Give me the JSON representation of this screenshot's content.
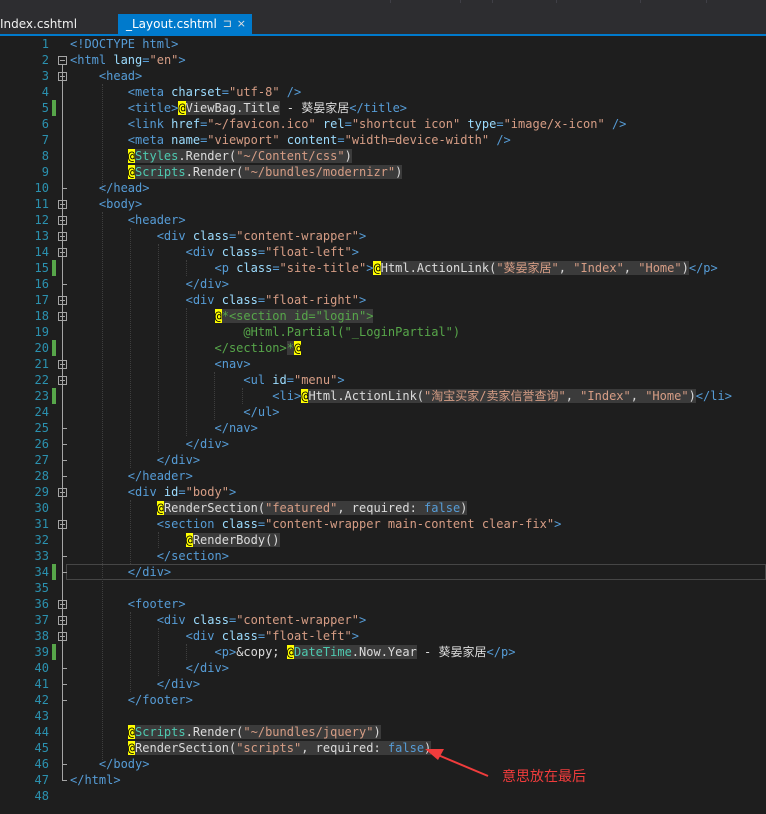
{
  "tabs": [
    {
      "label": "Index.cshtml",
      "active": false
    },
    {
      "label": "_Layout.cshtml",
      "active": true,
      "pin_icon": "⊐",
      "close_icon": "×"
    }
  ],
  "lines": [
    {
      "n": "1",
      "segs": [
        [
          "t",
          "<!DOCTYPE html>"
        ]
      ]
    },
    {
      "n": "2",
      "segs": [
        [
          "t",
          "<html "
        ],
        [
          "a",
          "lang"
        ],
        [
          "t",
          "="
        ],
        [
          "s",
          "\"en\""
        ],
        [
          "t",
          ">"
        ]
      ]
    },
    {
      "n": "3",
      "segs": [
        [
          "p",
          "    "
        ],
        [
          "t",
          "<head>"
        ]
      ]
    },
    {
      "n": "4",
      "segs": [
        [
          "p",
          "        "
        ],
        [
          "t",
          "<meta "
        ],
        [
          "a",
          "charset"
        ],
        [
          "t",
          "="
        ],
        [
          "s",
          "\"utf-8\""
        ],
        [
          "t",
          " />"
        ]
      ]
    },
    {
      "n": "5",
      "segs": [
        [
          "p",
          "        "
        ],
        [
          "t",
          "<title>"
        ],
        [
          "at",
          "@"
        ],
        [
          "r",
          "ViewBag.Title"
        ],
        [
          "p",
          " - 葵晏家居"
        ],
        [
          "t",
          "</title>"
        ]
      ]
    },
    {
      "n": "6",
      "segs": [
        [
          "p",
          "        "
        ],
        [
          "t",
          "<link "
        ],
        [
          "a",
          "href"
        ],
        [
          "t",
          "="
        ],
        [
          "s",
          "\"~/favicon.ico\""
        ],
        [
          "t",
          " "
        ],
        [
          "a",
          "rel"
        ],
        [
          "t",
          "="
        ],
        [
          "s",
          "\"shortcut icon\""
        ],
        [
          "t",
          " "
        ],
        [
          "a",
          "type"
        ],
        [
          "t",
          "="
        ],
        [
          "s",
          "\"image/x-icon\""
        ],
        [
          "t",
          " />"
        ]
      ]
    },
    {
      "n": "7",
      "segs": [
        [
          "p",
          "        "
        ],
        [
          "t",
          "<meta "
        ],
        [
          "a",
          "name"
        ],
        [
          "t",
          "="
        ],
        [
          "s",
          "\"viewport\""
        ],
        [
          "t",
          " "
        ],
        [
          "a",
          "content"
        ],
        [
          "t",
          "="
        ],
        [
          "s",
          "\"width=device-width\""
        ],
        [
          "t",
          " />"
        ]
      ]
    },
    {
      "n": "8",
      "segs": [
        [
          "p",
          "        "
        ],
        [
          "at",
          "@"
        ],
        [
          "rt",
          "Styles"
        ],
        [
          "r",
          ".Render("
        ],
        [
          "rs",
          "\"~/Content/css\""
        ],
        [
          "r",
          ")"
        ]
      ]
    },
    {
      "n": "9",
      "segs": [
        [
          "p",
          "        "
        ],
        [
          "at",
          "@"
        ],
        [
          "rt",
          "Scripts"
        ],
        [
          "r",
          ".Render("
        ],
        [
          "rs",
          "\"~/bundles/modernizr\""
        ],
        [
          "r",
          ")"
        ]
      ]
    },
    {
      "n": "10",
      "segs": [
        [
          "p",
          "    "
        ],
        [
          "t",
          "</head>"
        ]
      ]
    },
    {
      "n": "11",
      "segs": [
        [
          "p",
          "    "
        ],
        [
          "t",
          "<body>"
        ]
      ]
    },
    {
      "n": "12",
      "segs": [
        [
          "p",
          "        "
        ],
        [
          "t",
          "<header>"
        ]
      ]
    },
    {
      "n": "13",
      "segs": [
        [
          "p",
          "            "
        ],
        [
          "t",
          "<div "
        ],
        [
          "a",
          "class"
        ],
        [
          "t",
          "="
        ],
        [
          "s",
          "\"content-wrapper\""
        ],
        [
          "t",
          ">"
        ]
      ]
    },
    {
      "n": "14",
      "segs": [
        [
          "p",
          "                "
        ],
        [
          "t",
          "<div "
        ],
        [
          "a",
          "class"
        ],
        [
          "t",
          "="
        ],
        [
          "s",
          "\"float-left\""
        ],
        [
          "t",
          ">"
        ]
      ]
    },
    {
      "n": "15",
      "segs": [
        [
          "p",
          "                    "
        ],
        [
          "t",
          "<p "
        ],
        [
          "a",
          "class"
        ],
        [
          "t",
          "="
        ],
        [
          "s",
          "\"site-title\""
        ],
        [
          "t",
          ">"
        ],
        [
          "at",
          "@"
        ],
        [
          "r",
          "Html.ActionLink("
        ],
        [
          "rs",
          "\"葵晏家居\""
        ],
        [
          "r",
          ", "
        ],
        [
          "rs",
          "\"Index\""
        ],
        [
          "r",
          ", "
        ],
        [
          "rs",
          "\"Home\""
        ],
        [
          "r",
          ")"
        ],
        [
          "t",
          "</p>"
        ]
      ]
    },
    {
      "n": "16",
      "segs": [
        [
          "p",
          "                "
        ],
        [
          "t",
          "</div>"
        ]
      ]
    },
    {
      "n": "17",
      "segs": [
        [
          "p",
          "                "
        ],
        [
          "t",
          "<div "
        ],
        [
          "a",
          "class"
        ],
        [
          "t",
          "="
        ],
        [
          "s",
          "\"float-right\""
        ],
        [
          "t",
          ">"
        ]
      ]
    },
    {
      "n": "18",
      "segs": [
        [
          "p",
          "                    "
        ],
        [
          "at",
          "@"
        ],
        [
          "cm",
          "*<section id=\"login\">"
        ]
      ]
    },
    {
      "n": "19",
      "segs": [
        [
          "p",
          "                        "
        ],
        [
          "c",
          "@Html.Partial(\"_LoginPartial\")"
        ]
      ]
    },
    {
      "n": "20",
      "segs": [
        [
          "p",
          "                    "
        ],
        [
          "c",
          "</section>"
        ],
        [
          "cm",
          "*"
        ],
        [
          "at",
          "@"
        ]
      ]
    },
    {
      "n": "21",
      "segs": [
        [
          "p",
          "                    "
        ],
        [
          "t",
          "<nav>"
        ]
      ]
    },
    {
      "n": "22",
      "segs": [
        [
          "p",
          "                        "
        ],
        [
          "t",
          "<ul "
        ],
        [
          "a",
          "id"
        ],
        [
          "t",
          "="
        ],
        [
          "s",
          "\"menu\""
        ],
        [
          "t",
          ">"
        ]
      ]
    },
    {
      "n": "23",
      "segs": [
        [
          "p",
          "                            "
        ],
        [
          "t",
          "<li>"
        ],
        [
          "at",
          "@"
        ],
        [
          "r",
          "Html.ActionLink("
        ],
        [
          "rs",
          "\"淘宝买家/卖家信誉查询\""
        ],
        [
          "r",
          ", "
        ],
        [
          "rs",
          "\"Index\""
        ],
        [
          "r",
          ", "
        ],
        [
          "rs",
          "\"Home\""
        ],
        [
          "r",
          ")"
        ],
        [
          "t",
          "</li>"
        ]
      ]
    },
    {
      "n": "24",
      "segs": [
        [
          "p",
          "                        "
        ],
        [
          "t",
          "</ul>"
        ]
      ]
    },
    {
      "n": "25",
      "segs": [
        [
          "p",
          "                    "
        ],
        [
          "t",
          "</nav>"
        ]
      ]
    },
    {
      "n": "26",
      "segs": [
        [
          "p",
          "                "
        ],
        [
          "t",
          "</div>"
        ]
      ]
    },
    {
      "n": "27",
      "segs": [
        [
          "p",
          "            "
        ],
        [
          "t",
          "</div>"
        ]
      ]
    },
    {
      "n": "28",
      "segs": [
        [
          "p",
          "        "
        ],
        [
          "t",
          "</header>"
        ]
      ]
    },
    {
      "n": "29",
      "segs": [
        [
          "p",
          "        "
        ],
        [
          "t",
          "<div "
        ],
        [
          "a",
          "id"
        ],
        [
          "t",
          "="
        ],
        [
          "s",
          "\"body\""
        ],
        [
          "t",
          ">"
        ]
      ]
    },
    {
      "n": "30",
      "segs": [
        [
          "p",
          "            "
        ],
        [
          "at",
          "@"
        ],
        [
          "r",
          "RenderSection("
        ],
        [
          "rs",
          "\"featured\""
        ],
        [
          "r",
          ", required: "
        ],
        [
          "rk",
          "false"
        ],
        [
          "r",
          ")"
        ]
      ]
    },
    {
      "n": "31",
      "segs": [
        [
          "p",
          "            "
        ],
        [
          "t",
          "<section "
        ],
        [
          "a",
          "class"
        ],
        [
          "t",
          "="
        ],
        [
          "s",
          "\"content-wrapper main-content clear-fix\""
        ],
        [
          "t",
          ">"
        ]
      ]
    },
    {
      "n": "32",
      "segs": [
        [
          "p",
          "                "
        ],
        [
          "at",
          "@"
        ],
        [
          "r",
          "RenderBody()"
        ]
      ]
    },
    {
      "n": "33",
      "segs": [
        [
          "p",
          "            "
        ],
        [
          "t",
          "</section>"
        ]
      ]
    },
    {
      "n": "34",
      "segs": [
        [
          "p",
          "        "
        ],
        [
          "t",
          "</div>"
        ]
      ]
    },
    {
      "n": "35",
      "segs": []
    },
    {
      "n": "36",
      "segs": [
        [
          "p",
          "        "
        ],
        [
          "t",
          "<footer>"
        ]
      ]
    },
    {
      "n": "37",
      "segs": [
        [
          "p",
          "            "
        ],
        [
          "t",
          "<div "
        ],
        [
          "a",
          "class"
        ],
        [
          "t",
          "="
        ],
        [
          "s",
          "\"content-wrapper\""
        ],
        [
          "t",
          ">"
        ]
      ]
    },
    {
      "n": "38",
      "segs": [
        [
          "p",
          "                "
        ],
        [
          "t",
          "<div "
        ],
        [
          "a",
          "class"
        ],
        [
          "t",
          "="
        ],
        [
          "s",
          "\"float-left\""
        ],
        [
          "t",
          ">"
        ]
      ]
    },
    {
      "n": "39",
      "segs": [
        [
          "p",
          "                    "
        ],
        [
          "t",
          "<p>"
        ],
        [
          "p",
          "&copy; "
        ],
        [
          "at",
          "@"
        ],
        [
          "rt",
          "DateTime"
        ],
        [
          "r",
          ".Now.Year"
        ],
        [
          "p",
          " - 葵晏家居"
        ],
        [
          "t",
          "</p>"
        ]
      ]
    },
    {
      "n": "40",
      "segs": [
        [
          "p",
          "                "
        ],
        [
          "t",
          "</div>"
        ]
      ]
    },
    {
      "n": "41",
      "segs": [
        [
          "p",
          "            "
        ],
        [
          "t",
          "</div>"
        ]
      ]
    },
    {
      "n": "42",
      "segs": [
        [
          "p",
          "        "
        ],
        [
          "t",
          "</footer>"
        ]
      ]
    },
    {
      "n": "43",
      "segs": []
    },
    {
      "n": "44",
      "segs": [
        [
          "p",
          "        "
        ],
        [
          "at",
          "@"
        ],
        [
          "rt",
          "Scripts"
        ],
        [
          "r",
          ".Render("
        ],
        [
          "rs",
          "\"~/bundles/jquery\""
        ],
        [
          "r",
          ")"
        ]
      ]
    },
    {
      "n": "45",
      "segs": [
        [
          "p",
          "        "
        ],
        [
          "at",
          "@"
        ],
        [
          "r",
          "RenderSection("
        ],
        [
          "rs",
          "\"scripts\""
        ],
        [
          "r",
          ", required: "
        ],
        [
          "rk",
          "false"
        ],
        [
          "r",
          ")"
        ]
      ]
    },
    {
      "n": "46",
      "segs": [
        [
          "p",
          "    "
        ],
        [
          "t",
          "</body>"
        ]
      ]
    },
    {
      "n": "47",
      "segs": [
        [
          "t",
          "</html>"
        ]
      ]
    },
    {
      "n": "48",
      "segs": []
    }
  ],
  "annotation": {
    "text": "意思放在最后",
    "color": "#f03c3c"
  },
  "colors": {
    "background": "#1e1e1e",
    "line_number": "#2b91af",
    "tag": "#569cd6",
    "attribute": "#9cdcfe",
    "string": "#d69d85",
    "change_marker": "#57a64a",
    "tab_active": "#007acc"
  }
}
